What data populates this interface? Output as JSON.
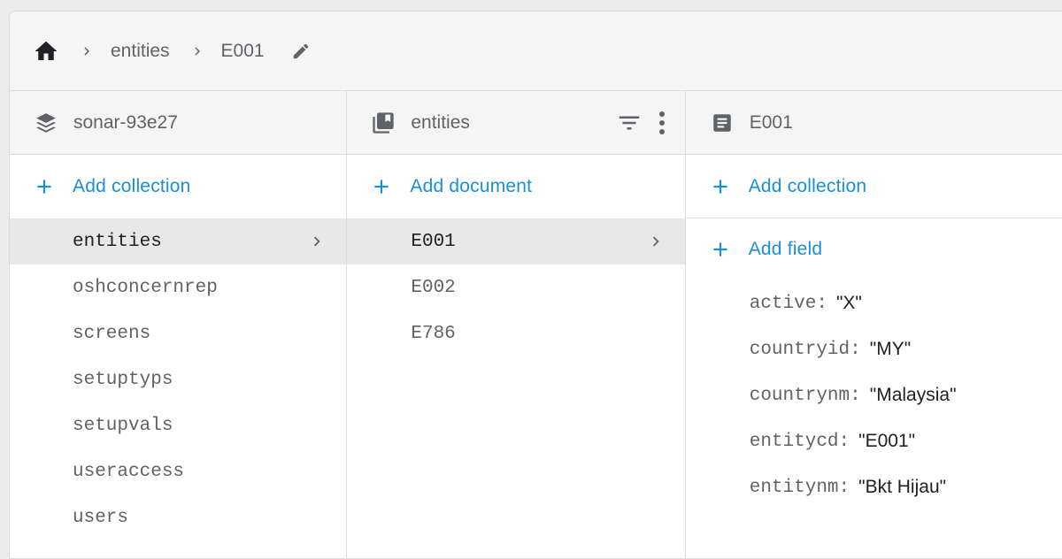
{
  "breadcrumb": {
    "items": [
      "entities",
      "E001"
    ]
  },
  "panels": {
    "root": {
      "title": "sonar-93e27",
      "add_label": "Add collection",
      "items": [
        "entities",
        "oshconcernrep",
        "screens",
        "setuptyps",
        "setupvals",
        "useraccess",
        "users"
      ],
      "selected": "entities"
    },
    "collection": {
      "title": "entities",
      "add_label": "Add document",
      "items": [
        "E001",
        "E002",
        "E786"
      ],
      "selected": "E001"
    },
    "document": {
      "title": "E001",
      "add_collection_label": "Add collection",
      "add_field_label": "Add field",
      "fields": [
        {
          "key": "active:",
          "value": "\"X\""
        },
        {
          "key": "countryid:",
          "value": "\"MY\""
        },
        {
          "key": "countrynm:",
          "value": "\"Malaysia\""
        },
        {
          "key": "entitycd:",
          "value": "\"E001\""
        },
        {
          "key": "entitynm:",
          "value": "\"Bkt Hijau\""
        }
      ]
    }
  },
  "colors": {
    "accent": "#1a8fd8",
    "selected_bg": "#e8e8e8",
    "header_bg": "#f5f5f5"
  }
}
